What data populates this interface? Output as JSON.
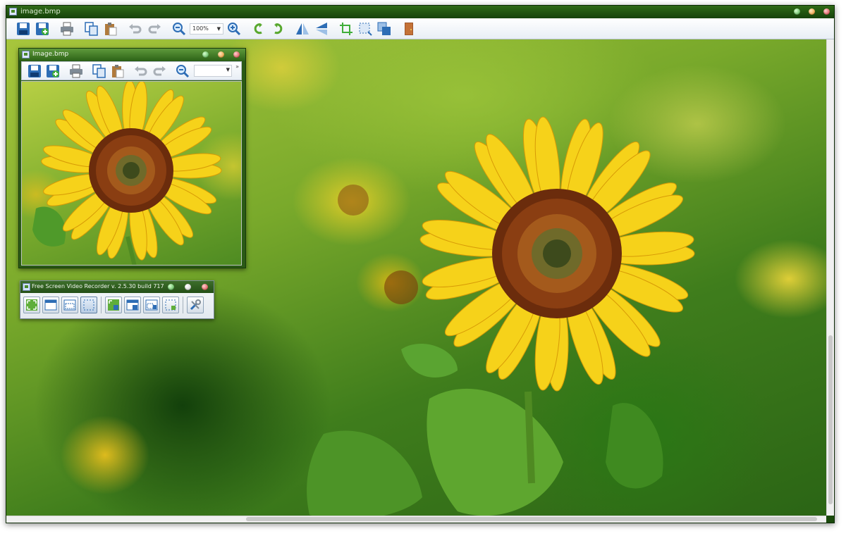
{
  "main_window": {
    "title": "image.bmp",
    "zoom_level": "100%",
    "toolbar": [
      {
        "name": "save-icon"
      },
      {
        "name": "save-as-icon"
      },
      {
        "name": "print-icon"
      },
      {
        "name": "copy-icon"
      },
      {
        "name": "paste-icon"
      },
      {
        "name": "undo-icon"
      },
      {
        "name": "redo-icon"
      },
      {
        "name": "zoom-out-icon"
      },
      {
        "name": "zoom-in-icon"
      },
      {
        "name": "rotate-left-icon"
      },
      {
        "name": "rotate-right-icon"
      },
      {
        "name": "flip-horizontal-icon"
      },
      {
        "name": "flip-vertical-icon"
      },
      {
        "name": "crop-icon"
      },
      {
        "name": "select-region-icon"
      },
      {
        "name": "resize-icon"
      },
      {
        "name": "exit-door-icon"
      }
    ]
  },
  "child_window": {
    "title": "Image.bmp",
    "more_label": "»"
  },
  "recorder_window": {
    "title": "Free Screen Video Recorder  v. 2.5.30 build 717",
    "buttons": [
      {
        "name": "capture-fullscreen-icon"
      },
      {
        "name": "capture-window-icon"
      },
      {
        "name": "capture-object-icon"
      },
      {
        "name": "capture-region-icon"
      },
      {
        "name": "record-fullscreen-icon"
      },
      {
        "name": "record-window-icon"
      },
      {
        "name": "record-object-icon"
      },
      {
        "name": "record-region-icon"
      },
      {
        "name": "settings-tools-icon"
      }
    ]
  },
  "colors": {
    "title_green": "#2f6a16",
    "toolbar_blue": "#2d6db5",
    "sunflower_yellow": "#f6d21a",
    "sunflower_center": "#8a3e12"
  }
}
